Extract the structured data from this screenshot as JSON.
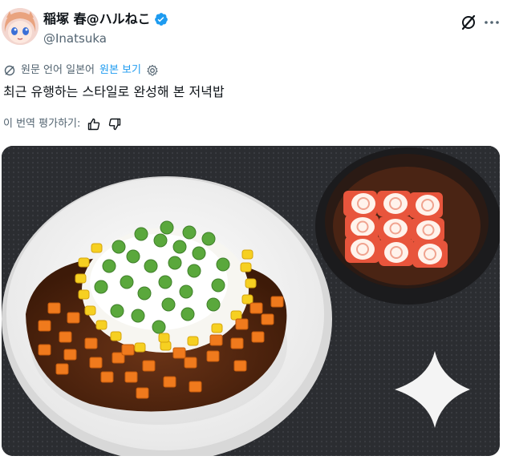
{
  "author": {
    "display_name": "稲塚 春@ハルねこ",
    "handle": "@Inatsuka",
    "verified": true
  },
  "translation": {
    "status_label": "원문 언어 일본어",
    "show_original_label": "원본 보기"
  },
  "tweet": {
    "text": "최근 유행하는 스타일로 완성해 본 저녁밥"
  },
  "rating": {
    "prompt": "이 번역 평가하기:"
  },
  "colors": {
    "accent": "#1d9bf0",
    "secondary_text": "#536471",
    "primary_text": "#0f1419"
  },
  "icons": [
    "grok-icon",
    "more-icon",
    "translate-icon",
    "settings-icon",
    "thumbs-up-icon",
    "thumbs-down-icon",
    "verified-badge-icon"
  ]
}
